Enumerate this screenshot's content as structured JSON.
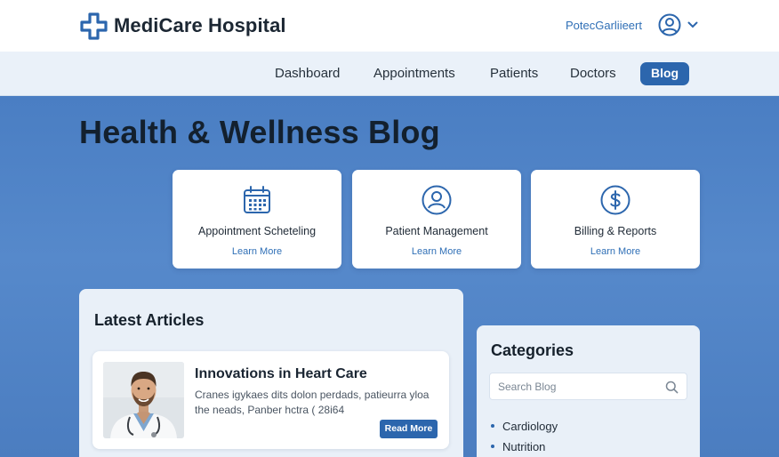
{
  "header": {
    "brand": "MediCare Hospital",
    "user_name": "PotecGarliieert",
    "icons": {
      "logo": "medical-cross-icon",
      "avatar": "user-circle-icon",
      "menu": "chevron-down-icon"
    }
  },
  "nav": {
    "items": [
      {
        "label": "Dashboard",
        "active": false
      },
      {
        "label": "Appointments",
        "active": false
      },
      {
        "label": "Patients",
        "active": false
      },
      {
        "label": "Doctors",
        "active": false
      },
      {
        "label": "Blog",
        "active": true
      }
    ]
  },
  "page": {
    "title": "Health & Wellness Blog"
  },
  "features": [
    {
      "title": "Appointment Scheteling",
      "link": "Learn More",
      "icon": "calendar-icon"
    },
    {
      "title": "Patient Management",
      "link": "Learn More",
      "icon": "user-icon"
    },
    {
      "title": "Billing & Reports",
      "link": "Learn More",
      "icon": "dollar-icon"
    }
  ],
  "articles": {
    "heading": "Latest Articles",
    "items": [
      {
        "title": "Innovations in Heart Care",
        "excerpt": "Cranes igykaes dits dolon perdads, patieurra yloa the neads, Panber hctra ( 28i64",
        "button": "Read More",
        "image": "doctor-portrait"
      }
    ]
  },
  "categories": {
    "heading": "Categories",
    "search_placeholder": "Search Blog",
    "items": [
      "Cardiology",
      "Nutrition"
    ]
  },
  "colors": {
    "accent": "#2c66ad",
    "background": "#4a7fc4",
    "link": "#2f6fb6"
  }
}
